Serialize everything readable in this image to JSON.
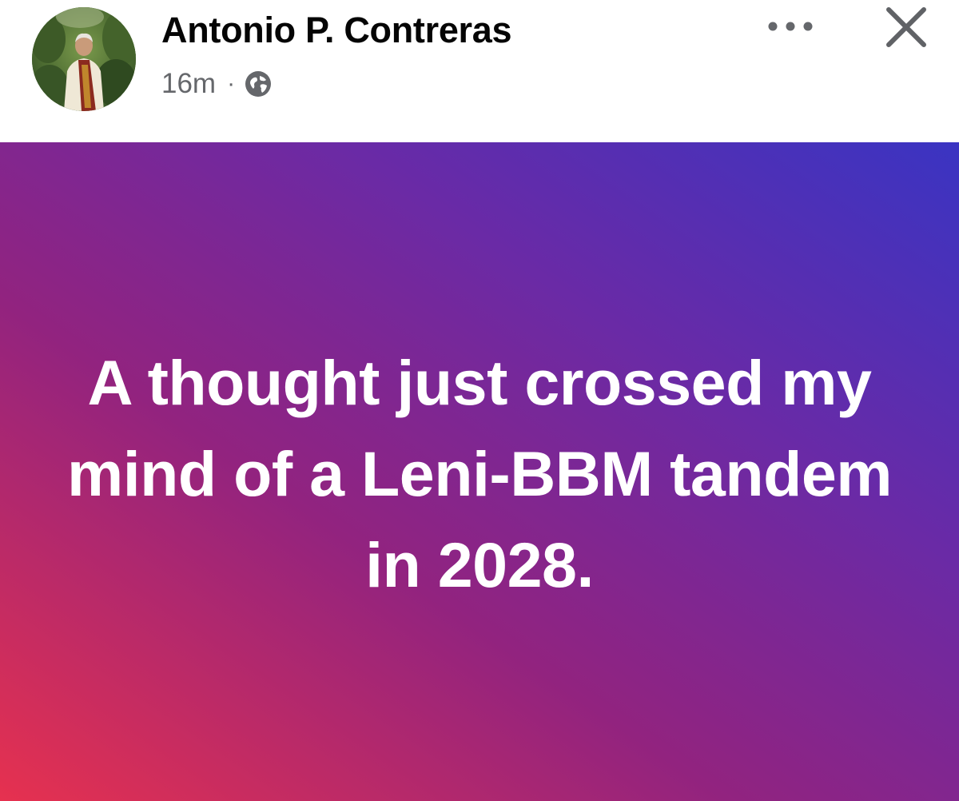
{
  "post": {
    "author_name": "Antonio P. Contreras",
    "timestamp": "16m",
    "separator": "·",
    "audience_icon": "globe-icon",
    "more_icon": "more-horizontal-icon",
    "close_icon": "close-icon",
    "text": "A thought just crossed my mind of a Leni-BBM tandem in 2028.",
    "background_gradient": [
      "#e6314f",
      "#92237f",
      "#6a2aa6",
      "#3a34c2"
    ],
    "text_color": "#ffffff"
  }
}
